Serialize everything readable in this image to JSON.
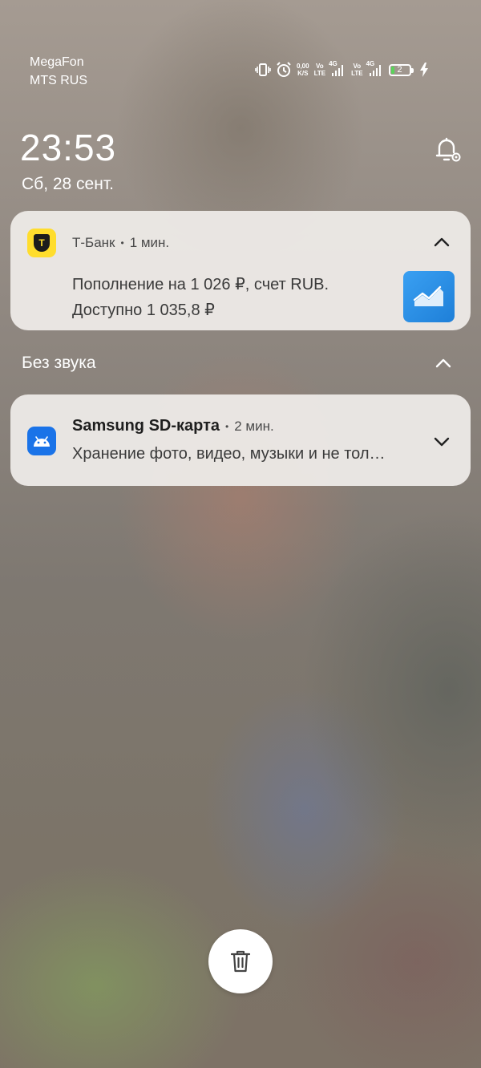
{
  "status_bar": {
    "carrier_1": "MegaFon",
    "carrier_2": "MTS RUS",
    "net_speed_value": "0,00",
    "net_speed_unit": "K/S",
    "volte_1": "Vo",
    "volte_1_sub": "LTE",
    "net_1": "4G",
    "volte_2": "Vo",
    "volte_2_sub": "LTE",
    "net_2": "4G",
    "battery_level": "2",
    "icons": [
      "vibrate-icon",
      "alarm-icon",
      "signal-icon",
      "charging-icon"
    ]
  },
  "lockscreen": {
    "time": "23:53",
    "date": "Сб, 28 сент."
  },
  "notifications": [
    {
      "app": "Т-Банк",
      "time": "1 мин.",
      "line_1": "Пополнение на 1 026 ₽, счет RUB.",
      "line_2": "Доступно 1 035,8 ₽",
      "icon_letter": "Т",
      "accent": "#ffdd2d"
    }
  ],
  "silent_section": {
    "label": "Без звука",
    "notifications": [
      {
        "title": "Samsung SD-карта",
        "time": "2 мин.",
        "text": "Хранение фото, видео, музыки и не тол…",
        "accent": "#1a73e8"
      }
    ]
  },
  "colors": {
    "card_bg": "#ece9e6",
    "text_primary": "#1e1e1e",
    "text_secondary": "#4a4a4a"
  }
}
